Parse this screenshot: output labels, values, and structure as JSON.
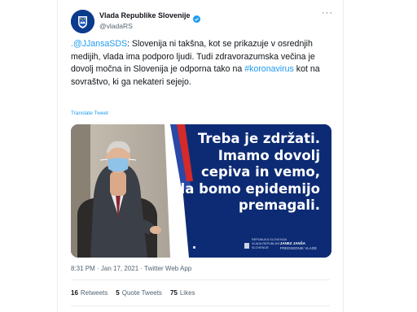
{
  "account": {
    "display_name": "Vlada Republike Slovenije",
    "handle": "@vladaRS"
  },
  "tweet": {
    "mention": ".@JJansaSDS",
    "text_1": ": Slovenija ni takšna, kot se prikazuje v osrednjih medijih, vlada ima podporo ljudi. Tudi zdravorazumska večina je dovolj močna in Slovenija je odporna tako na ",
    "hashtag": "#koronavirus",
    "text_2": " kot na sovraštvo, ki ga nekateri sejejo.",
    "translate_label": "Translate Tweet",
    "timestamp": "8:31 PM · Jan 17, 2021 · Twitter Web App"
  },
  "media": {
    "quote_lines": [
      "Treba je zdržati.",
      "Imamo dovolj",
      "cepiva in vemo,",
      "da bomo epidemijo",
      "premagali."
    ],
    "footer_org_1": "REPUBLIKA SLOVENIJA",
    "footer_org_2": "VLADA REPUBLIKE SLOVENIJE",
    "footer_name": "JANEZ JANŠA",
    "footer_role": "PREDSEDNIK VLADE"
  },
  "stats": {
    "retweets_count": "16",
    "retweets_label": "Retweets",
    "quotes_count": "5",
    "quotes_label": "Quote Tweets",
    "likes_count": "75",
    "likes_label": "Likes"
  },
  "icons": {
    "avatar": "government-crest-icon",
    "verified": "verified-badge-icon",
    "more": "more-icon"
  },
  "colors": {
    "link": "#1d9bf0",
    "text": "#0f1419",
    "secondary": "#536471",
    "media_bg": "#0d2b74"
  }
}
